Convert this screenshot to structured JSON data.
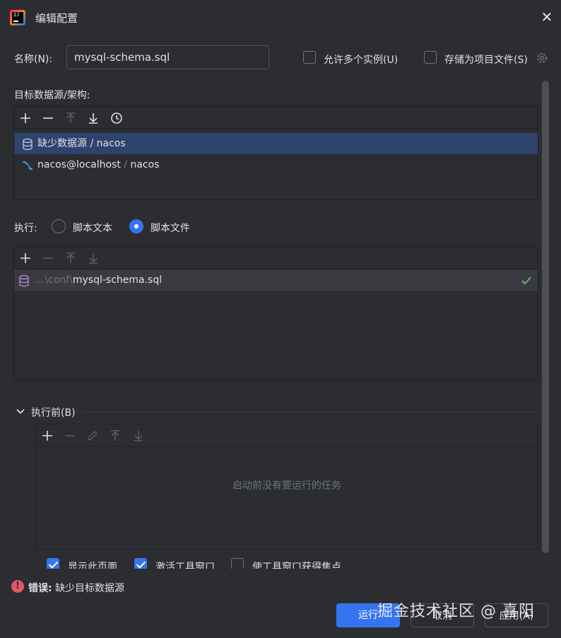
{
  "window": {
    "title": "编辑配置",
    "close_glyph": "✕"
  },
  "name_field": {
    "label": "名称(N):",
    "value": "mysql-schema.sql"
  },
  "options": {
    "allow_multiple": {
      "label": "允许多个实例(U)",
      "checked": false
    },
    "store_as_project": {
      "label": "存储为项目文件(S)",
      "checked": false
    }
  },
  "target": {
    "label": "目标数据源/架构:",
    "toolbar": [
      "add-icon",
      "remove-icon",
      "move-up-icon",
      "move-down-icon",
      "history-icon"
    ],
    "items": [
      {
        "text": "缺少数据源 / nacos",
        "icon": "database-icon",
        "selected": true
      },
      {
        "name": "nacos@localhost",
        "sep": " / ",
        "schema": "nacos",
        "icon": "mysql-dolphin-icon",
        "selected": false
      }
    ]
  },
  "execute": {
    "label": "执行:",
    "options": [
      {
        "label": "脚本文本",
        "selected": false
      },
      {
        "label": "脚本文件",
        "selected": true
      }
    ]
  },
  "files": {
    "toolbar": [
      "add-icon",
      "remove-icon",
      "move-up-icon",
      "move-down-icon"
    ],
    "items": [
      {
        "prefix": "...\\conf\\",
        "name": "mysql-schema.sql",
        "icon": "sql-file-icon",
        "status": "check-icon"
      }
    ]
  },
  "before_launch": {
    "header": "执行前(B)",
    "toolbar": [
      "add-icon",
      "remove-icon",
      "edit-icon",
      "move-up-icon",
      "move-down-icon"
    ],
    "empty_text": "启动前没有要运行的任务"
  },
  "bottom_checks": [
    {
      "label": "显示此页面",
      "checked": true
    },
    {
      "label": "激活工具窗口",
      "checked": true
    },
    {
      "label": "使工具窗口获得焦点",
      "checked": false
    }
  ],
  "error": {
    "prefix": "错误:",
    "message": "缺少目标数据源"
  },
  "buttons": {
    "run": "运行",
    "cancel": "取消",
    "apply": "应用(A)"
  },
  "watermark": "掘金技术社区 @ 喜阳",
  "colors": {
    "background": "#2b2d30",
    "accent": "#3574f0",
    "selection": "#2e436e",
    "error": "#e55765",
    "success": "#5fb865"
  }
}
